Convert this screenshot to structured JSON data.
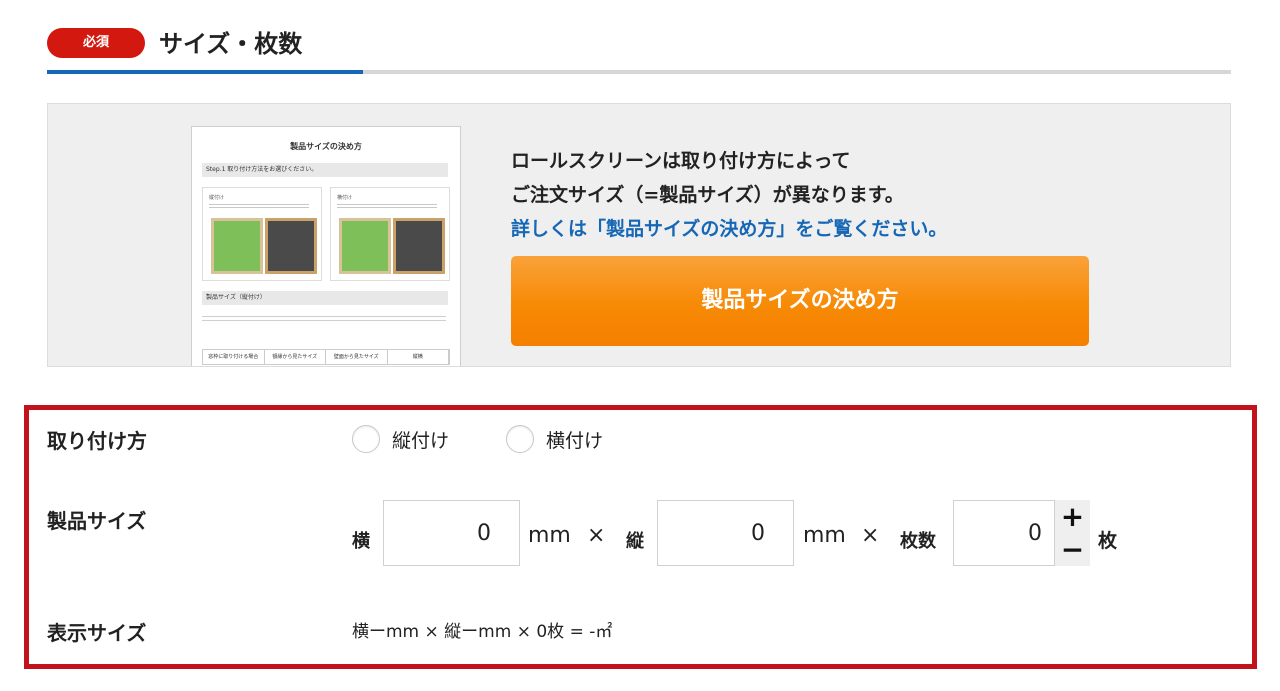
{
  "section": {
    "required_badge": "必須",
    "title": "サイズ・枚数"
  },
  "info": {
    "line1": "ロールスクリーンは取り付け方によって",
    "line2": "ご注文サイズ（=製品サイズ）が異なります。",
    "link_text": "詳しくは「製品サイズの決め方」をご覧ください。",
    "button_label": "製品サイズの決め方",
    "doc_preview": {
      "title": "製品サイズの決め方",
      "step_bar": "Step.1 取り付け方法をお選びください。",
      "card1_label": "縦付け",
      "card2_label": "横付け",
      "size_bar": "製品サイズ（縦付け）",
      "tabs": [
        "窓枠に取り付ける場合",
        "額縁から見たサイズ",
        "壁面から見たサイズ",
        "縦横"
      ]
    }
  },
  "form": {
    "mounting": {
      "label": "取り付け方",
      "options": [
        "縦付け",
        "横付け"
      ]
    },
    "product_size": {
      "label": "製品サイズ",
      "width_label": "横",
      "width_value": "0",
      "height_label": "縦",
      "height_value": "0",
      "unit": "mm",
      "times": "×",
      "count_label": "枚数",
      "count_value": "0",
      "count_unit": "枚",
      "plus": "+",
      "minus": "−"
    },
    "display_size": {
      "label": "表示サイズ",
      "value": "横ーmm × 縦ーmm × 0枚 = -㎡"
    }
  },
  "colors": {
    "required_red": "#d2180f",
    "accent_blue": "#1667b5",
    "button_orange": "#f78a05",
    "frame_red": "#c2121b"
  }
}
